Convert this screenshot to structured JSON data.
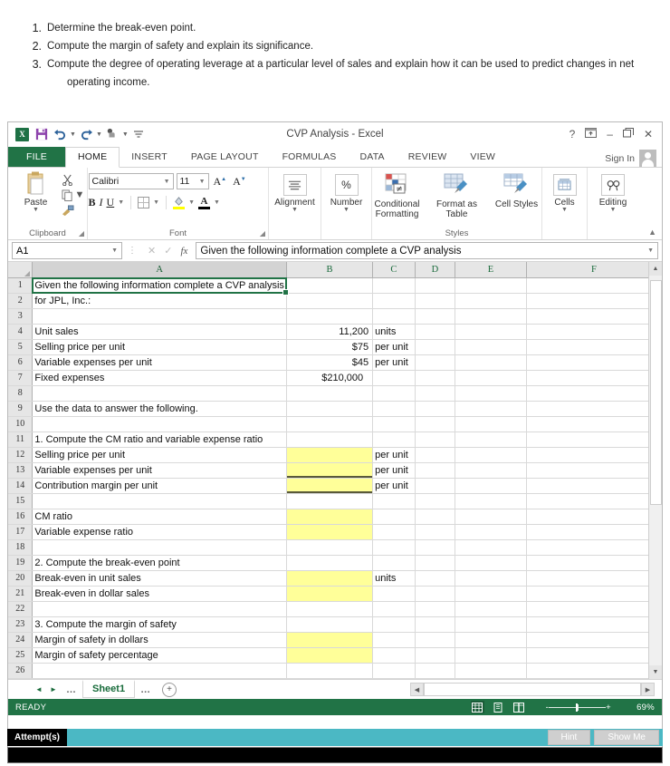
{
  "questions": [
    {
      "num": "1.",
      "text": "Determine the break-even point.",
      "cont": ""
    },
    {
      "num": "2.",
      "text": "Compute the margin of safety and explain its significance.",
      "cont": ""
    },
    {
      "num": "3.",
      "text": "Compute the degree of operating leverage at a particular level of sales and explain how it can be used to predict changes in net",
      "cont": "operating income."
    }
  ],
  "window": {
    "title": "CVP Analysis - Excel",
    "app_logo": "X",
    "help": "?",
    "ribbon_display": "ribbon-display-options",
    "minimize": "–",
    "restore": "❐",
    "close": "✕",
    "sign_in": "Sign In"
  },
  "quick_access": [
    "save-icon",
    "undo-icon",
    "redo-icon",
    "touch-mode-icon",
    "customize-qat-icon"
  ],
  "ribbon": {
    "tabs": [
      {
        "label": "FILE",
        "active": false,
        "file": true
      },
      {
        "label": "HOME",
        "active": true,
        "file": false
      },
      {
        "label": "INSERT",
        "active": false,
        "file": false
      },
      {
        "label": "PAGE LAYOUT",
        "active": false,
        "file": false
      },
      {
        "label": "FORMULAS",
        "active": false,
        "file": false
      },
      {
        "label": "DATA",
        "active": false,
        "file": false
      },
      {
        "label": "REVIEW",
        "active": false,
        "file": false
      },
      {
        "label": "VIEW",
        "active": false,
        "file": false
      }
    ],
    "groups": {
      "clipboard": {
        "label": "Clipboard",
        "paste": "Paste"
      },
      "font": {
        "label": "Font",
        "font_name": "Calibri",
        "font_size": "11",
        "grow": "A",
        "shrink": "A",
        "bold": "B",
        "italic": "I",
        "underline": "U"
      },
      "alignment": {
        "label": "Alignment"
      },
      "number": {
        "label": "Number",
        "glyph": "%"
      },
      "styles": {
        "label": "Styles",
        "conditional": "Conditional Formatting",
        "format_table": "Format as Table",
        "cell_styles": "Cell Styles"
      },
      "cells": {
        "label": "Cells"
      },
      "editing": {
        "label": "Editing"
      }
    }
  },
  "formula_bar": {
    "name_box": "A1",
    "cancel": "✕",
    "enter": "✓",
    "fx": "fx",
    "content": "Given the following information complete a CVP analysis"
  },
  "grid": {
    "columns": [
      "A",
      "B",
      "C",
      "D",
      "E",
      "F"
    ],
    "selected_column": "A",
    "rows": [
      {
        "n": "1",
        "a": "Given the following information complete a CVP analysis",
        "b": "",
        "c": "",
        "style": "active-overflow"
      },
      {
        "n": "2",
        "a": "for JPL, Inc.:",
        "b": "",
        "c": ""
      },
      {
        "n": "3",
        "a": "",
        "b": "",
        "c": ""
      },
      {
        "n": "4",
        "a": "Unit sales",
        "b": "11,200",
        "c": "units"
      },
      {
        "n": "5",
        "a": "Selling price per unit",
        "b": "$75",
        "c": "per unit"
      },
      {
        "n": "6",
        "a": "Variable expenses per unit",
        "b": "$45",
        "c": "per unit"
      },
      {
        "n": "7",
        "a": "Fixed expenses",
        "b": "$210,000",
        "c": "",
        "b_indent": true
      },
      {
        "n": "8",
        "a": "",
        "b": "",
        "c": ""
      },
      {
        "n": "9",
        "a": "Use the data to answer the following.",
        "b": "",
        "c": ""
      },
      {
        "n": "10",
        "a": "",
        "b": "",
        "c": ""
      },
      {
        "n": "11",
        "a": "1. Compute the CM ratio and variable expense ratio",
        "b": "",
        "c": ""
      },
      {
        "n": "12",
        "a": "Selling price per unit",
        "b": "",
        "c": "per unit",
        "yellow": true
      },
      {
        "n": "13",
        "a": "Variable expenses per unit",
        "b": "",
        "c": "per unit",
        "yellow": true,
        "bottom_border": true
      },
      {
        "n": "14",
        "a": "Contribution margin per unit",
        "b": "",
        "c": "per unit",
        "yellow": true,
        "bottom_border": true
      },
      {
        "n": "15",
        "a": "",
        "b": "",
        "c": ""
      },
      {
        "n": "16",
        "a": "CM ratio",
        "b": "",
        "c": "",
        "yellow": true
      },
      {
        "n": "17",
        "a": "Variable expense ratio",
        "b": "",
        "c": "",
        "yellow": true
      },
      {
        "n": "18",
        "a": "",
        "b": "",
        "c": ""
      },
      {
        "n": "19",
        "a": "2. Compute the break-even point",
        "b": "",
        "c": ""
      },
      {
        "n": "20",
        "a": "Break-even in unit sales",
        "b": "",
        "c": "units",
        "yellow": true
      },
      {
        "n": "21",
        "a": "Break-even in dollar sales",
        "b": "",
        "c": "",
        "yellow": true
      },
      {
        "n": "22",
        "a": "",
        "b": "",
        "c": ""
      },
      {
        "n": "23",
        "a": "3. Compute the margin of safety",
        "b": "",
        "c": ""
      },
      {
        "n": "24",
        "a": "Margin of safety in dollars",
        "b": "",
        "c": "",
        "yellow": true
      },
      {
        "n": "25",
        "a": "Margin of safety percentage",
        "b": "",
        "c": "",
        "yellow": true
      },
      {
        "n": "26",
        "a": "",
        "b": "",
        "c": ""
      }
    ]
  },
  "sheet_bar": {
    "first": "◄",
    "last": "►",
    "left_ellipsis": "…",
    "right_ellipsis": "…",
    "tab": "Sheet1",
    "add": "+"
  },
  "status_bar": {
    "state": "READY",
    "zoom": "69%",
    "views": [
      "normal-view-icon",
      "page-layout-icon",
      "page-break-icon"
    ],
    "zoom_out": "-",
    "zoom_in": "+"
  },
  "attempt_bar": {
    "label": "Attempt(s)",
    "hint": "Hint",
    "show_me": "Show Me"
  },
  "colors": {
    "excel_green": "#217346",
    "highlight_yellow": "#ffff99",
    "attempt_teal": "#4bb8c4"
  }
}
